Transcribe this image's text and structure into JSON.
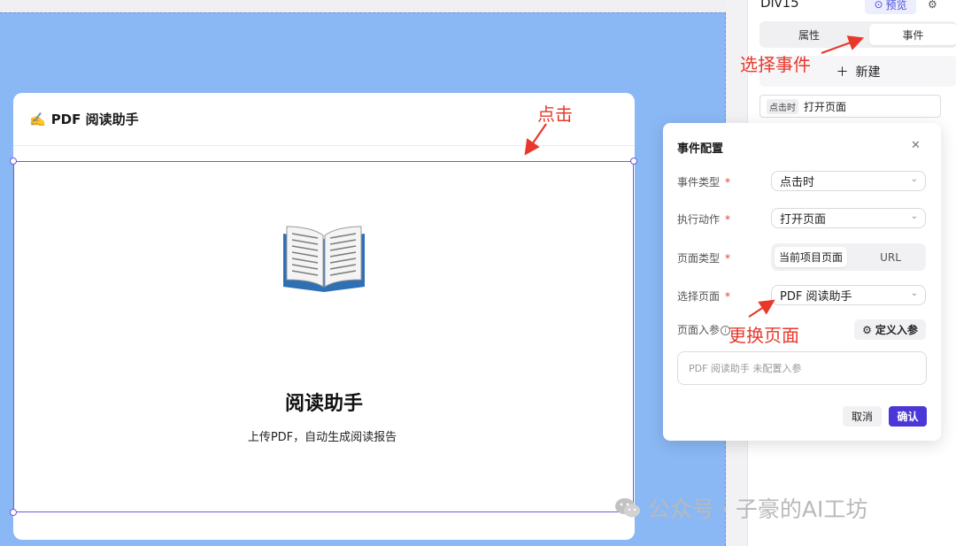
{
  "canvas": {
    "card": {
      "header_title": "PDF 阅读助手",
      "header_emoji": "✍️",
      "book_icon": "open-book-icon",
      "title": "阅读助手",
      "subtitle": "上传PDF，自动生成阅读报告"
    }
  },
  "right_panel": {
    "component_name": "Div15",
    "preview_label": "预览",
    "tabs": [
      {
        "label": "属性",
        "active": false
      },
      {
        "label": "事件",
        "active": true
      }
    ],
    "new_button_label": "新建",
    "event_item": {
      "tag": "点击时",
      "action": "打开页面"
    }
  },
  "dialog": {
    "title": "事件配置",
    "fields": {
      "event_type": {
        "label": "事件类型",
        "value": "点击时"
      },
      "action": {
        "label": "执行动作",
        "value": "打开页面"
      },
      "page_type": {
        "label": "页面类型",
        "options": [
          "当前项目页面",
          "URL"
        ],
        "selected": "当前项目页面"
      },
      "select_page": {
        "label": "选择页面",
        "value": "PDF 阅读助手"
      },
      "page_params": {
        "label": "页面入参",
        "button": "定义入参",
        "placeholder": "PDF 阅读助手 未配置入参"
      }
    },
    "cancel_label": "取消",
    "confirm_label": "确认"
  },
  "annotations": {
    "click": "点击",
    "select_event": "选择事件",
    "change_page": "更换页面",
    "color": "#e8382c"
  },
  "watermark": {
    "text": "公众号 · 子豪的AI工坊"
  },
  "colors": {
    "canvas_bg": "#8ab8f4",
    "accent": "#4b37d8",
    "selection": "#6b5be0"
  }
}
